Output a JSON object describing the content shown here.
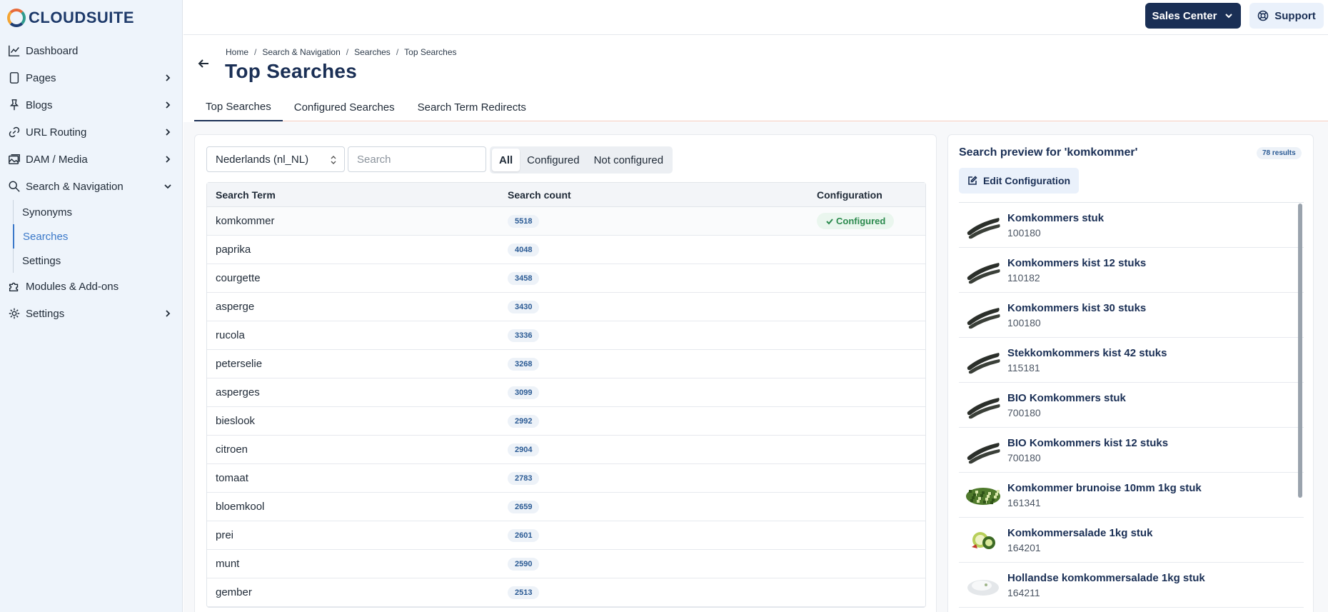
{
  "brand": {
    "name": "CLOUDSUITE"
  },
  "sidebar": {
    "items": [
      {
        "label": "Dashboard",
        "icon": "chart-line-icon"
      },
      {
        "label": "Pages",
        "icon": "page-icon"
      },
      {
        "label": "Blogs",
        "icon": "pin-icon"
      },
      {
        "label": "URL Routing",
        "icon": "link-icon"
      },
      {
        "label": "DAM / Media",
        "icon": "images-icon"
      },
      {
        "label": "Search & Navigation",
        "icon": "search-icon"
      },
      {
        "label": "Modules & Add-ons",
        "icon": "puzzle-icon"
      },
      {
        "label": "Settings",
        "icon": "gear-icon"
      }
    ],
    "sub_items": [
      {
        "label": "Synonyms"
      },
      {
        "label": "Searches"
      },
      {
        "label": "Settings"
      }
    ]
  },
  "topbar": {
    "sales_label": "Sales Center",
    "support_label": "Support"
  },
  "breadcrumb": [
    "Home",
    "Search & Navigation",
    "Searches",
    "Top Searches"
  ],
  "page_title": "Top Searches",
  "tabs": [
    "Top Searches",
    "Configured Searches",
    "Search Term Redirects"
  ],
  "filters": {
    "language": "Nederlands (nl_NL)",
    "search_placeholder": "Search",
    "segments": [
      "All",
      "Configured",
      "Not configured"
    ]
  },
  "table": {
    "headers": [
      "Search Term",
      "Search count",
      "Configuration"
    ],
    "rows": [
      {
        "term": "komkommer",
        "count": "5518",
        "config": "Configured"
      },
      {
        "term": "paprika",
        "count": "4048",
        "config": ""
      },
      {
        "term": "courgette",
        "count": "3458",
        "config": ""
      },
      {
        "term": "asperge",
        "count": "3430",
        "config": ""
      },
      {
        "term": "rucola",
        "count": "3336",
        "config": ""
      },
      {
        "term": "peterselie",
        "count": "3268",
        "config": ""
      },
      {
        "term": "asperges",
        "count": "3099",
        "config": ""
      },
      {
        "term": "bieslook",
        "count": "2992",
        "config": ""
      },
      {
        "term": "citroen",
        "count": "2904",
        "config": ""
      },
      {
        "term": "tomaat",
        "count": "2783",
        "config": ""
      },
      {
        "term": "bloemkool",
        "count": "2659",
        "config": ""
      },
      {
        "term": "prei",
        "count": "2601",
        "config": ""
      },
      {
        "term": "munt",
        "count": "2590",
        "config": ""
      },
      {
        "term": "gember",
        "count": "2513",
        "config": ""
      }
    ]
  },
  "preview": {
    "title": "Search preview for 'komkommer'",
    "results": "78 results",
    "edit_label": "Edit Configuration",
    "products": [
      {
        "name": "Komkommers stuk",
        "code": "100180",
        "thumb": "cucumber"
      },
      {
        "name": "Komkommers kist 12 stuks",
        "code": "110182",
        "thumb": "cucumber"
      },
      {
        "name": "Komkommers kist 30 stuks",
        "code": "100180",
        "thumb": "cucumber"
      },
      {
        "name": "Stekkomkommers kist 42 stuks",
        "code": "115181",
        "thumb": "cucumber"
      },
      {
        "name": "BIO Komkommers stuk",
        "code": "700180",
        "thumb": "cucumber"
      },
      {
        "name": "BIO Komkommers kist 12 stuks",
        "code": "700180",
        "thumb": "cucumber"
      },
      {
        "name": "Komkommer brunoise 10mm 1kg stuk",
        "code": "161341",
        "thumb": "diced"
      },
      {
        "name": "Komkommersalade 1kg stuk",
        "code": "164201",
        "thumb": "salad"
      },
      {
        "name": "Hollandse komkommersalade 1kg stuk",
        "code": "164211",
        "thumb": "white-salad"
      }
    ]
  }
}
